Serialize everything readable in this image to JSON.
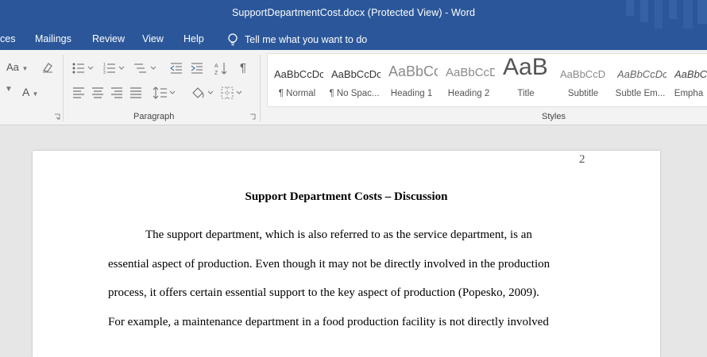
{
  "window": {
    "title": "SupportDepartmentCost.docx (Protected View)  -  Word"
  },
  "menu": {
    "tabs": [
      "ces",
      "Mailings",
      "Review",
      "View",
      "Help"
    ],
    "tell_me": "Tell me what you want to do"
  },
  "ribbon": {
    "font_group": {
      "case_label": "Aa",
      "font_color_label": "A"
    },
    "paragraph_group_label": "Paragraph",
    "styles_group_label": "Styles",
    "pilcrow": "¶",
    "styles": [
      {
        "sample": "AaBbCcDc",
        "name": "¶ Normal"
      },
      {
        "sample": "AaBbCcDc",
        "name": "¶ No Spac..."
      },
      {
        "sample": "AaBbCc",
        "name": "Heading 1"
      },
      {
        "sample": "AaBbCcD",
        "name": "Heading 2"
      },
      {
        "sample": "AaB",
        "name": "Title"
      },
      {
        "sample": "AaBbCcD",
        "name": "Subtitle"
      },
      {
        "sample": "AaBbCcDc",
        "name": "Subtle Em..."
      },
      {
        "sample": "AaBbCcDc",
        "name": "Empha"
      }
    ]
  },
  "document": {
    "page_number": "2",
    "heading": "Support Department Costs – Discussion",
    "lines": [
      "The support department, which is also referred to as the service department, is an",
      "essential aspect of production. Even though it may not be directly involved in the production",
      "process, it offers certain essential support to the key aspect of production (Popesko, 2009).",
      "For example, a maintenance department in a food production facility is not directly involved"
    ]
  },
  "colors": {
    "titlebar": "#2b579a",
    "ribbon": "#f3f3f3",
    "canvas": "#e6e6e6"
  }
}
